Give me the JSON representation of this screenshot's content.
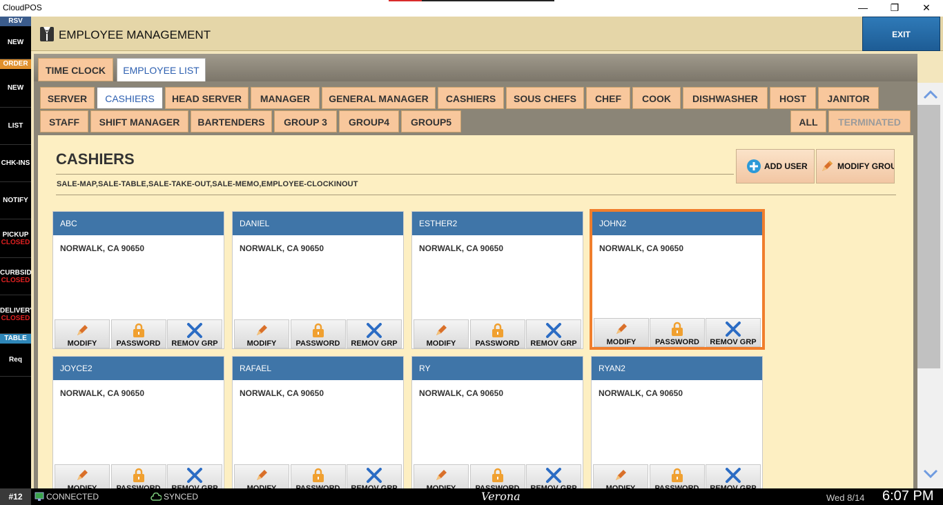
{
  "window": {
    "title": "CloudPOS",
    "minimize": "—",
    "restore": "❐",
    "close": "✕"
  },
  "sidebar": {
    "rsv_header": "RSV",
    "rsv_new": "NEW",
    "order_header": "ORDER",
    "order_new": "NEW",
    "list": "LIST",
    "chk_ins": "CHK-INS",
    "notify": "NOTIFY",
    "pickup": "PICKUP",
    "pickup_status": "CLOSED",
    "curbside": "CURBSIDE",
    "curbside_status": "CLOSED",
    "delivery": "DELIVERY",
    "delivery_status": "CLOSED",
    "table_header": "TABLE",
    "req": "Req"
  },
  "header": {
    "title": "EMPLOYEE MANAGEMENT",
    "exit_label": "EXIT",
    "icon": "tuxedo-icon"
  },
  "tabs": [
    {
      "label": "TIME CLOCK",
      "active": false
    },
    {
      "label": "EMPLOYEE LIST",
      "active": true
    }
  ],
  "groups_row1": [
    "SERVER",
    "CASHIERS",
    "HEAD SERVER",
    "MANAGER",
    "GENERAL MANAGER",
    "CASHIERS",
    "SOUS CHEFS",
    "CHEF",
    "COOK",
    "DISHWASHER",
    "HOST",
    "JANITOR"
  ],
  "groups_row2": [
    "STAFF",
    "SHIFT MANAGER",
    "BARTENDERS",
    "GROUP 3",
    "GROUP4",
    "GROUP5"
  ],
  "filters": {
    "all": "ALL",
    "terminated": "TERMINATED"
  },
  "selected_group": {
    "title": "CASHIERS",
    "permissions": "SALE-MAP,SALE-TABLE,SALE-TAKE-OUT,SALE-MEMO,EMPLOYEE-CLOCKINOUT",
    "add_user_label": "ADD USER",
    "modify_group_label": "MODIFY GROU"
  },
  "card_buttons": {
    "modify": "MODIFY",
    "password": "PASSWORD",
    "remove": "REMOV GRP"
  },
  "employees": [
    {
      "name": "ABC",
      "address": "NORWALK, CA 90650"
    },
    {
      "name": "DANIEL",
      "address": "NORWALK, CA 90650"
    },
    {
      "name": "ESTHER2",
      "address": "NORWALK, CA 90650"
    },
    {
      "name": "JOHN2",
      "address": "NORWALK, CA 90650"
    },
    {
      "name": "JOYCE2",
      "address": "NORWALK, CA 90650"
    },
    {
      "name": "RAFAEL",
      "address": "NORWALK, CA 90650"
    },
    {
      "name": "RY",
      "address": "NORWALK, CA 90650"
    },
    {
      "name": "RYAN2",
      "address": "NORWALK, CA 90650"
    }
  ],
  "status": {
    "station": "#12",
    "connection": "CONNECTED",
    "sync": "SYNCED",
    "store": "Verona",
    "date": "Wed 8/14",
    "time": "6:07 PM"
  },
  "colors": {
    "accent_blue": "#3f75a8",
    "tab_orange": "#f8c79c",
    "selected_border": "#f07e2c",
    "closed_red": "#e02020"
  }
}
